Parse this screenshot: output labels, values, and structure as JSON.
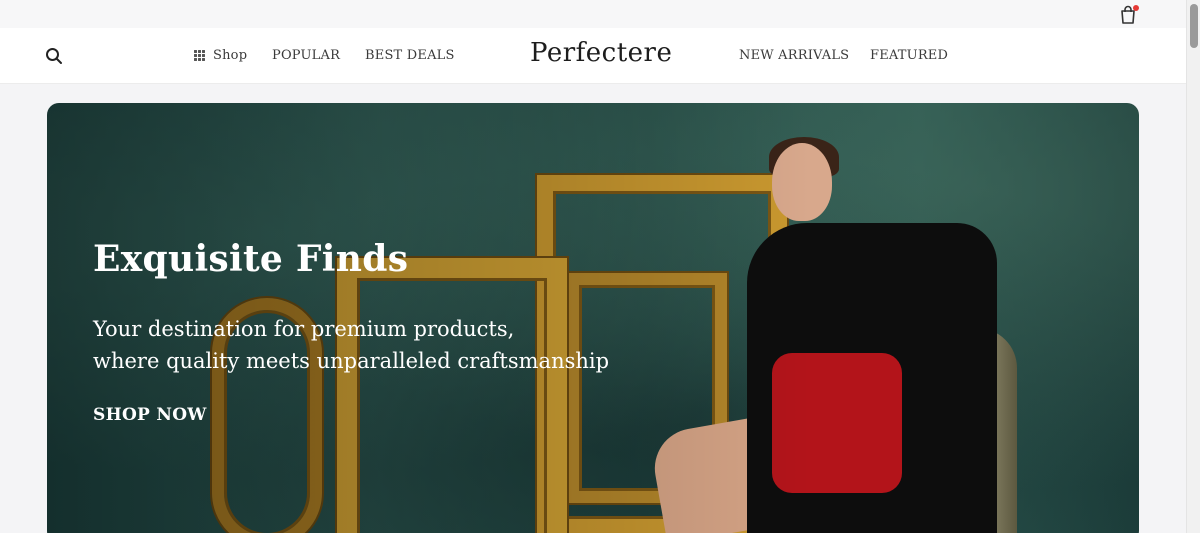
{
  "topbar": {
    "cart_icon": "shopping-bag-icon",
    "cart_badge_color": "#e53935"
  },
  "nav": {
    "search_icon": "search-icon",
    "shop_icon": "grid-icon",
    "shop_label": "Shop",
    "left_links": [
      "POPULAR",
      "BEST DEALS"
    ],
    "logo": "Perfectere",
    "right_links": [
      "NEW ARRIVALS",
      "FEATURED"
    ]
  },
  "hero": {
    "title": "Exquisite Finds",
    "subtitle_line1": "Your destination for premium products,",
    "subtitle_line2": "where quality meets unparalleled craftsmanship",
    "cta": "SHOP NOW"
  }
}
